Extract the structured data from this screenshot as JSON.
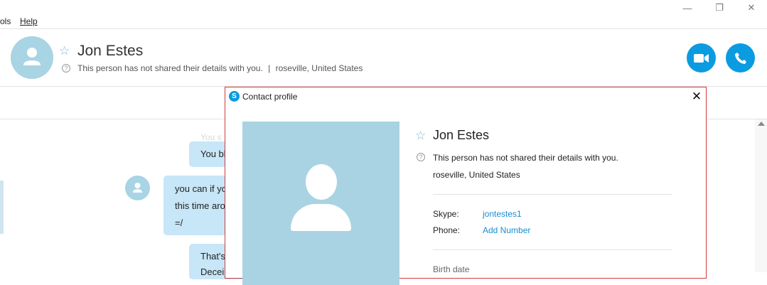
{
  "window": {
    "minimize": "—",
    "restore": "❐",
    "close": "✕"
  },
  "menu": {
    "tools_partial": "ols",
    "help": "Help"
  },
  "header": {
    "contact_name": "Jon Estes",
    "status": "This person has not shared their details with you.",
    "separator": "|",
    "location": "roseville, United States",
    "video_call_icon": "video-camera-icon",
    "audio_call_icon": "phone-icon"
  },
  "chat": {
    "faded_label": "You s",
    "messages": [
      {
        "lines": [
          "You bl"
        ]
      },
      {
        "lines": [
          "you can if yo",
          "this time aro",
          "=/"
        ]
      },
      {
        "lines": [
          "That's",
          "Decei"
        ]
      }
    ]
  },
  "dialog": {
    "title": "Contact profile",
    "close": "✕",
    "contact_name": "Jon Estes",
    "status": "This person has not shared their details with you.",
    "location": "roseville, United States",
    "fields": [
      {
        "label": "Skype:",
        "value": "jontestes1"
      },
      {
        "label": "Phone:",
        "value": "Add Number"
      }
    ],
    "birth_date_label": "Birth date"
  },
  "colors": {
    "accent": "#0b9be1",
    "bubble": "#c7e6f7",
    "avatar_bg": "#a8d4e4",
    "dialog_border": "#d23a3a"
  }
}
